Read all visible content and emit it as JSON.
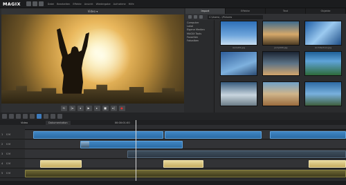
{
  "app": {
    "logo": "MAGIX"
  },
  "menubar": {
    "items": [
      "Datei",
      "Bearbeiten",
      "Effekte",
      "Ansicht",
      "Wiedergabe",
      "Aufnahme",
      "Hilfe"
    ]
  },
  "preview": {
    "title": "Video ▾"
  },
  "pool": {
    "tabs": [
      "Import",
      "Effekte",
      "Text",
      "Objekte"
    ],
    "path": "C:\\Users\\…\\Pictures",
    "tree": [
      "Computer",
      "Lokal",
      "Eigene Medien",
      "MAGIX Tools",
      "Favoriten",
      "Fotoalben"
    ],
    "thumbs": [
      {
        "label": "Aerial01.jpg",
        "kind": "sky-plane"
      },
      {
        "label": "Jump006.jpg",
        "kind": "jump"
      },
      {
        "label": "Architecture.jpg",
        "kind": "building"
      },
      {
        "label": "",
        "kind": "building-blue"
      },
      {
        "label": "",
        "kind": "runner"
      },
      {
        "label": "",
        "kind": "palm"
      },
      {
        "label": "",
        "kind": "boats"
      },
      {
        "label": "",
        "kind": "cyclist"
      },
      {
        "label": "",
        "kind": "cyclist2"
      }
    ]
  },
  "timeline": {
    "name": "Video",
    "scene": "Dokumentation",
    "timecode": "00:00:01:00",
    "tracks": [
      {
        "num": "1",
        "label": "S M"
      },
      {
        "num": "2",
        "label": "S M"
      },
      {
        "num": "3",
        "label": "S M"
      },
      {
        "num": "4",
        "label": "S M"
      },
      {
        "num": "5",
        "label": "S M"
      }
    ]
  },
  "colors": {
    "accent": "#3d7bbd",
    "clip_blue": "#2b6aa3",
    "clip_gold": "#c5ad60",
    "record": "#e53030"
  }
}
